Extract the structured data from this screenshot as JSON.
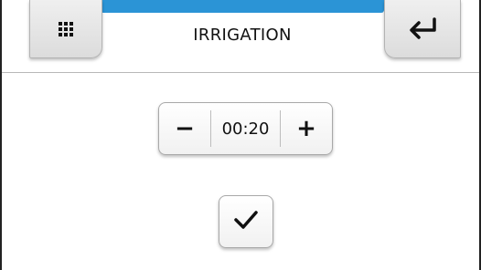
{
  "header": {
    "title": "IRRIGATION",
    "accent_color": "#2b94d6",
    "menu_icon": "grid-menu-icon",
    "back_icon": "return-arrow-icon"
  },
  "stepper": {
    "decrement_label": "−",
    "value": "00:20",
    "increment_label": "+"
  },
  "confirm": {
    "icon": "checkmark-icon"
  }
}
